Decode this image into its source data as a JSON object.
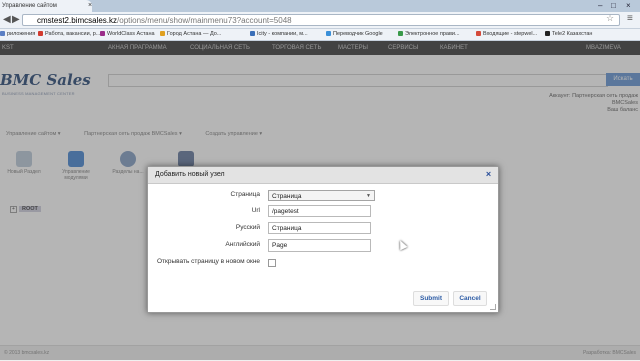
{
  "browser": {
    "tab_title": "Управление сайтом",
    "tab_close": "×",
    "window_controls": [
      "–",
      "□",
      "×"
    ],
    "url_domain": "cmstest2.bimcsales.kz",
    "url_path": "/options/menu/show/mainmenu73?account=5048",
    "bookmarks": [
      {
        "label": "риложения",
        "color": "#5b7fc4"
      },
      {
        "label": "Работа, вакансии, р...",
        "color": "#d23b2f"
      },
      {
        "label": "WorldClass Астана",
        "color": "#9b2d8a"
      },
      {
        "label": "Город Астана — Дo...",
        "color": "#e0a020"
      },
      {
        "label": "Icity - компании, м...",
        "color": "#3a6fb8"
      },
      {
        "label": "Переводчик Google",
        "color": "#3a8fd8"
      },
      {
        "label": "Электронное прави...",
        "color": "#3a9a4a"
      },
      {
        "label": "Входящие - stepwel...",
        "color": "#d44a3a"
      },
      {
        "label": "Tele2 Казахстан",
        "color": "#222222"
      }
    ]
  },
  "site": {
    "nav": [
      "KST",
      "АКНАЯ ПРАГРАММА",
      "СОЦИАЛЬНАЯ СЕТЬ",
      "ТОРГОВАЯ СЕТЬ",
      "МАСТЕРЫ",
      "СЕРВИСЫ",
      "КАБИНЕТ",
      "MBAZIMEVA"
    ],
    "logo": "BMC Sales",
    "logo_sub": "BUSINESS MANAGEMENT CENTER",
    "search_button": "Искать",
    "account_lines": [
      "Аккаунт: Партнерская сеть продаж",
      "BMCSales",
      "Ваш баланс"
    ],
    "breadcrumbs": [
      "Управление сайтом ▾",
      "Партнерская сеть продаж BMCSales ▾",
      "Создать управление ▾"
    ],
    "tools": [
      "Новый Раздел",
      "Управление модулями",
      "Разделы на...",
      ""
    ],
    "tree_root": "ROOT",
    "footer_left": "© 2013 bmcsales.kz",
    "footer_right": "Разработка: BMCSales"
  },
  "dialog": {
    "title": "Добавить новый узел",
    "close": "×",
    "fields": {
      "page_label": "Страница",
      "page_value": "Страница",
      "url_label": "Url",
      "url_value": "/pagetest",
      "ru_label": "Русский",
      "ru_value": "Страница",
      "en_label": "Английский",
      "en_value": "Page",
      "newwin_label": "Открывать страницу в новом окне"
    },
    "submit": "Submit",
    "cancel": "Cancel"
  }
}
